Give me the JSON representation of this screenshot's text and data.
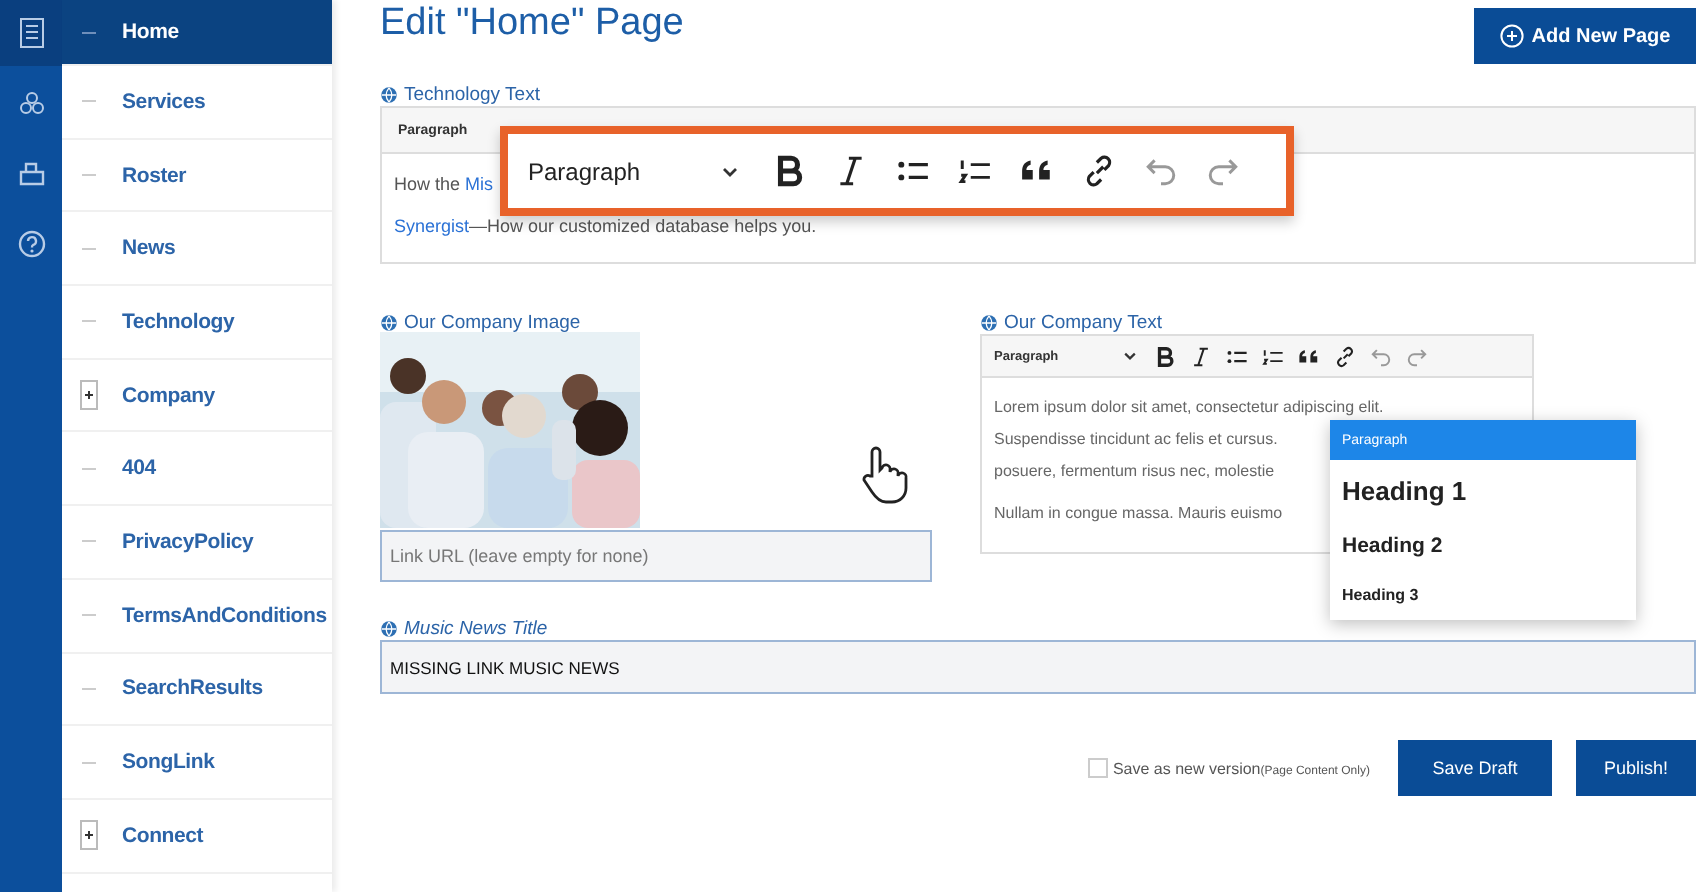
{
  "rail_icons": [
    {
      "kind": "pages",
      "selected": true
    },
    {
      "kind": "people",
      "selected": false
    },
    {
      "kind": "box",
      "selected": false
    },
    {
      "kind": "help",
      "selected": false
    }
  ],
  "sidebar": {
    "items": [
      {
        "label": "Home",
        "kind": "leaf",
        "selected": true
      },
      {
        "label": "Services",
        "kind": "leaf",
        "selected": false
      },
      {
        "label": "Roster",
        "kind": "leaf",
        "selected": false
      },
      {
        "label": "News",
        "kind": "leaf",
        "selected": false
      },
      {
        "label": "Technology",
        "kind": "leaf",
        "selected": false
      },
      {
        "label": "Company",
        "kind": "folder",
        "selected": false
      },
      {
        "label": "404",
        "kind": "leaf",
        "selected": false
      },
      {
        "label": "PrivacyPolicy",
        "kind": "leaf",
        "selected": false
      },
      {
        "label": "TermsAndConditions",
        "kind": "leaf",
        "selected": false
      },
      {
        "label": "SearchResults",
        "kind": "leaf",
        "selected": false
      },
      {
        "label": "SongLink",
        "kind": "leaf",
        "selected": false
      },
      {
        "label": "Connect",
        "kind": "folder",
        "selected": false
      }
    ]
  },
  "title": "Edit \"Home\" Page",
  "add_button": "Add New Page",
  "technology_text": {
    "label": "Technology Text",
    "format": "Paragraph",
    "lines": [
      [
        {
          "text": "How the ",
          "link": false
        },
        {
          "text": "Mis",
          "link": true
        }
      ],
      [
        {
          "text": "Synergist",
          "link": true
        },
        {
          "text": "—How our customized database helps you.",
          "link": false
        }
      ]
    ]
  },
  "callout_toolbar": {
    "format": "Paragraph"
  },
  "company_image": {
    "label": "Our Company Image",
    "kind": "picture",
    "link_placeholder": "Link URL (leave empty for none)"
  },
  "company_text": {
    "label": "Our Company Text",
    "format": "Paragraph",
    "paragraphs": [
      [
        "Lorem ipsum dolor sit amet, consectetur adipiscing elit.",
        "Suspendisse tincidunt ac felis et cursus.",
        "posuere, fermentum risus nec, molestie"
      ],
      [
        "Nullam in congue massa. Mauris euismo"
      ]
    ]
  },
  "format_menu": [
    {
      "label": "Paragraph",
      "kind": "paragraph",
      "selected": true
    },
    {
      "label": "Heading 1",
      "kind": "h1",
      "selected": false
    },
    {
      "label": "Heading 2",
      "kind": "h2",
      "selected": false
    },
    {
      "label": "Heading 3",
      "kind": "h3",
      "selected": false
    }
  ],
  "music_news_title": {
    "label": "Music News Title",
    "value": "MISSING LINK MUSIC NEWS"
  },
  "save_new_version": {
    "label": "Save as new version",
    "note": "(Page Content Only)",
    "checked": false
  },
  "buttons": [
    "Save Draft",
    "Publish!"
  ]
}
